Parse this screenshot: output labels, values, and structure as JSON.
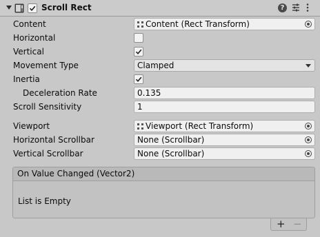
{
  "header": {
    "title": "Scroll Rect",
    "enabled": true,
    "help_glyph": "?",
    "icons": [
      "foldout-arrow-icon",
      "scroll-rect-component-icon",
      "help-icon",
      "presets-icon",
      "kebab-menu-icon"
    ]
  },
  "fields": {
    "content": {
      "label": "Content",
      "value": "Content (Rect Transform)"
    },
    "horizontal": {
      "label": "Horizontal",
      "checked": false
    },
    "vertical": {
      "label": "Vertical",
      "checked": true
    },
    "movement_type": {
      "label": "Movement Type",
      "value": "Clamped"
    },
    "inertia": {
      "label": "Inertia",
      "checked": true
    },
    "deceleration_rate": {
      "label": "Deceleration Rate",
      "value": "0.135"
    },
    "scroll_sensitivity": {
      "label": "Scroll Sensitivity",
      "value": "1"
    },
    "viewport": {
      "label": "Viewport",
      "value": "Viewport (Rect Transform)"
    },
    "horizontal_scrollbar": {
      "label": "Horizontal Scrollbar",
      "value": "None (Scrollbar)"
    },
    "vertical_scrollbar": {
      "label": "Vertical Scrollbar",
      "value": "None (Scrollbar)"
    }
  },
  "event": {
    "title": "On Value Changed (Vector2)",
    "empty_text": "List is Empty",
    "add_label": "+",
    "remove_label": "−"
  }
}
